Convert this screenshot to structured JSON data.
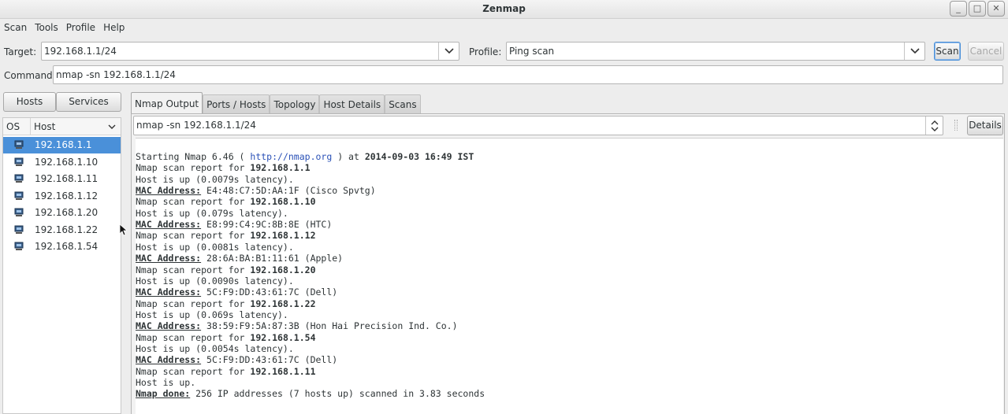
{
  "window": {
    "title": "Zenmap",
    "controls": [
      "_",
      "□",
      "✕"
    ]
  },
  "menu": [
    "Scan",
    "Tools",
    "Profile",
    "Help"
  ],
  "toolbar": {
    "target_label": "Target:",
    "target_value": "192.168.1.1/24",
    "profile_label": "Profile:",
    "profile_value": "Ping scan",
    "scan_label": "Scan",
    "cancel_label": "Cancel",
    "command_label": "Command:",
    "command_value": "nmap -sn 192.168.1.1/24"
  },
  "left": {
    "hosts_button": "Hosts",
    "services_button": "Services",
    "col_os": "OS",
    "col_host": "Host",
    "hosts": [
      "192.168.1.1",
      "192.168.1.10",
      "192.168.1.11",
      "192.168.1.12",
      "192.168.1.20",
      "192.168.1.22",
      "192.168.1.54"
    ],
    "selected_index": 0
  },
  "tabs": [
    "Nmap Output",
    "Ports / Hosts",
    "Topology",
    "Host Details",
    "Scans"
  ],
  "active_tab": 0,
  "output": {
    "command_select": "nmap -sn 192.168.1.1/24",
    "details_label": "Details",
    "lines": [
      [
        {
          "t": "Starting Nmap 6.46 ( "
        },
        {
          "t": "http://nmap.org",
          "s": "link"
        },
        {
          "t": " ) at "
        },
        {
          "t": "2014-09-03 16:49 IST",
          "s": "b"
        }
      ],
      [
        {
          "t": "Nmap scan report for "
        },
        {
          "t": "192.168.1.1",
          "s": "b"
        }
      ],
      [
        {
          "t": "Host is up (0.0079s latency)."
        }
      ],
      [
        {
          "t": "MAC Address:",
          "s": "u"
        },
        {
          "t": " E4:48:C7:5D:AA:1F (Cisco Spvtg)"
        }
      ],
      [
        {
          "t": "Nmap scan report for "
        },
        {
          "t": "192.168.1.10",
          "s": "b"
        }
      ],
      [
        {
          "t": "Host is up (0.079s latency)."
        }
      ],
      [
        {
          "t": "MAC Address:",
          "s": "u"
        },
        {
          "t": " E8:99:C4:9C:8B:8E (HTC)"
        }
      ],
      [
        {
          "t": "Nmap scan report for "
        },
        {
          "t": "192.168.1.12",
          "s": "b"
        }
      ],
      [
        {
          "t": "Host is up (0.0081s latency)."
        }
      ],
      [
        {
          "t": "MAC Address:",
          "s": "u"
        },
        {
          "t": " 28:6A:BA:B1:11:61 (Apple)"
        }
      ],
      [
        {
          "t": "Nmap scan report for "
        },
        {
          "t": "192.168.1.20",
          "s": "b"
        }
      ],
      [
        {
          "t": "Host is up (0.0090s latency)."
        }
      ],
      [
        {
          "t": "MAC Address:",
          "s": "u"
        },
        {
          "t": " 5C:F9:DD:43:61:7C (Dell)"
        }
      ],
      [
        {
          "t": "Nmap scan report for "
        },
        {
          "t": "192.168.1.22",
          "s": "b"
        }
      ],
      [
        {
          "t": "Host is up (0.069s latency)."
        }
      ],
      [
        {
          "t": "MAC Address:",
          "s": "u"
        },
        {
          "t": " 38:59:F9:5A:87:3B (Hon Hai Precision Ind. Co.)"
        }
      ],
      [
        {
          "t": "Nmap scan report for "
        },
        {
          "t": "192.168.1.54",
          "s": "b"
        }
      ],
      [
        {
          "t": "Host is up (0.0054s latency)."
        }
      ],
      [
        {
          "t": "MAC Address:",
          "s": "u"
        },
        {
          "t": " 5C:F9:DD:43:61:7C (Dell)"
        }
      ],
      [
        {
          "t": "Nmap scan report for "
        },
        {
          "t": "192.168.1.11",
          "s": "b"
        }
      ],
      [
        {
          "t": "Host is up."
        }
      ],
      [
        {
          "t": "Nmap done:",
          "s": "u"
        },
        {
          "t": " 256 IP addresses (7 hosts up) scanned in 3.83 seconds"
        }
      ]
    ]
  },
  "colors": {
    "accent": "#4a90d9",
    "link": "#2a51b7"
  },
  "icons": {
    "combo_arrow": "chevron-down-icon",
    "spin_arrows": "up-down-arrows-icon",
    "os_icon": "os-generic-icon"
  }
}
